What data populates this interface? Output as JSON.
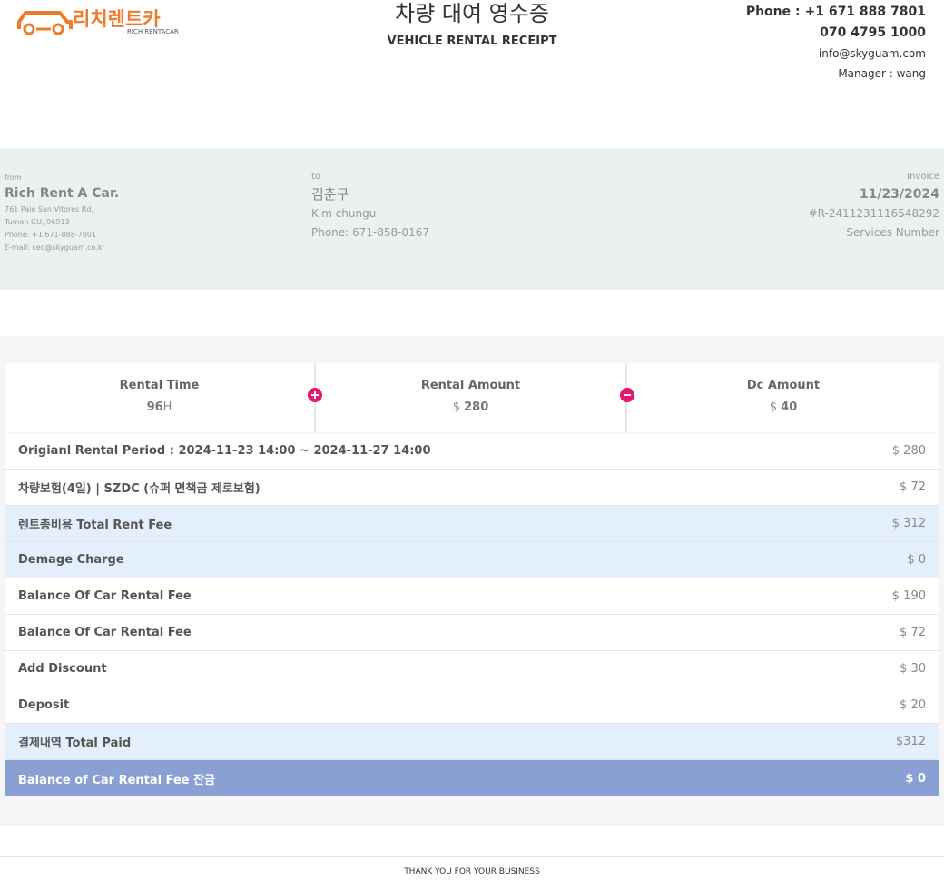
{
  "brand": {
    "name_ko": "리치렌트카",
    "name_en": "RICH RENTACAR",
    "accent": "#f07a28"
  },
  "header": {
    "title_ko": "차량 대여 영수증",
    "title_en": "VEHICLE RENTAL RECEIPT"
  },
  "contact": {
    "phone": "Phone : +1 671 888 7801",
    "phone2": "070 4795 1000",
    "email": "info@skyguam.com",
    "manager": "Manager : wang"
  },
  "from": {
    "label": "from",
    "name": "Rich Rent A Car.",
    "address": "761 Pale San Vitores Rd,",
    "city": "Tumon GU, 96913",
    "phone": "Phone: +1 671-888-7801",
    "email": "E-mail: ceo@skyguam.co.kr"
  },
  "to": {
    "label": "to",
    "name_ko": "김춘구",
    "name_en": "Kim chungu",
    "phone": "Phone: 671-858-0167"
  },
  "invoice": {
    "label": "Invoice",
    "date": "11/23/2024",
    "number": "#R-2411231116548292",
    "services": "Services Number"
  },
  "summary": {
    "rental_time": {
      "label": "Rental Time",
      "value_num": "96",
      "value_unit": "H"
    },
    "rental_amount": {
      "label": "Rental Amount",
      "currency": "$",
      "value": "280"
    },
    "dc_amount": {
      "label": "Dc Amount",
      "currency": "$",
      "value": "40"
    }
  },
  "rows": [
    {
      "label": "Origianl Rental Period : 2024-11-23 14:00 ~ 2024-11-27 14:00",
      "value": "$ 280",
      "style": "white"
    },
    {
      "label": "차량보험(4일) | SZDC (슈퍼 면책금 제로보험)",
      "value": "$ 72",
      "style": "white"
    },
    {
      "label": "렌트총비용 Total Rent Fee",
      "value": "$ 312",
      "style": "blue"
    },
    {
      "label": "Demage Charge",
      "value": "$ 0",
      "style": "blue"
    },
    {
      "label": "Balance Of Car Rental Fee",
      "value": "$ 190",
      "style": "white"
    },
    {
      "label": "Balance Of Car Rental Fee",
      "value": "$ 72",
      "style": "white"
    },
    {
      "label": "Add Discount",
      "value": "$ 30",
      "style": "white"
    },
    {
      "label": "Deposit",
      "value": "$ 20",
      "style": "white"
    },
    {
      "label": "결제내역 Total Paid",
      "value": "$312",
      "style": "blue"
    },
    {
      "label": "Balance of Car Rental Fee 잔금",
      "value": "$ 0",
      "style": "dark"
    }
  ],
  "footer": {
    "text": "THANK YOU FOR YOUR BUSINESS"
  },
  "colors": {
    "band": "#ecf0f1",
    "row_blue": "#e3effd",
    "row_dark": "#8aa0d4",
    "icon_pink": "#e8166f"
  }
}
